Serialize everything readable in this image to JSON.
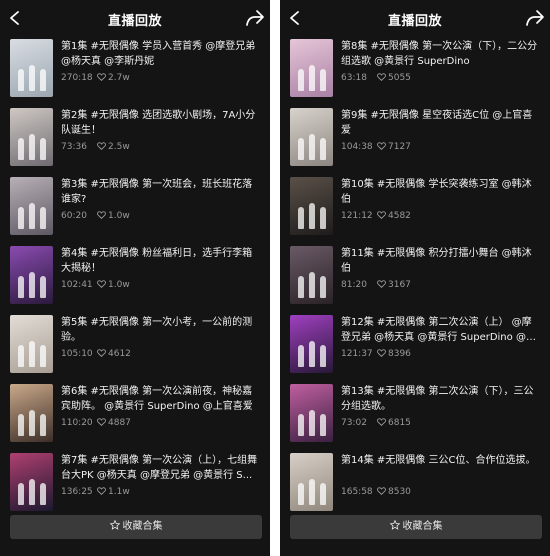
{
  "colors": {
    "background": "#141414",
    "text": "#f2f2f2",
    "meta": "#9a9a9a",
    "button": "#3a3a3a"
  },
  "left_panel": {
    "title": "直播回放",
    "button_label": "收藏合集",
    "episodes": [
      {
        "title": "第1集 #无限偶像 学员入营首秀 @摩登兄弟 @杨天真 @李斯丹妮",
        "duration": "270:18",
        "likes": "2.7w"
      },
      {
        "title": "第2集 #无限偶像 选团选歌小剧场，7A小分队诞生！",
        "duration": "73:36",
        "likes": "2.5w"
      },
      {
        "title": "第3集 #无限偶像 第一次班会，班长班花落谁家?",
        "duration": "60:20",
        "likes": "1.0w"
      },
      {
        "title": "第4集 #无限偶像 粉丝福利日，选手行李箱大揭秘！",
        "duration": "102:41",
        "likes": "1.0w"
      },
      {
        "title": "第5集 #无限偶像 第一次小考，一公前的测验。",
        "duration": "105:10",
        "likes": "4612"
      },
      {
        "title": "第6集 #无限偶像 第一次公演前夜，神秘嘉宾助阵。 @黄景行 SuperDino @上官喜爱",
        "duration": "110:20",
        "likes": "4887"
      },
      {
        "title": "第7集 #无限偶像 第一次公演（上），七组舞台大PK @杨天真 @摩登兄弟 @黄景行 S...",
        "duration": "136:25",
        "likes": "1.1w"
      }
    ]
  },
  "right_panel": {
    "title": "直播回放",
    "button_label": "收藏合集",
    "episodes": [
      {
        "title": "第8集 #无限偶像 第一次公演（下），二公分组选歌 @黄景行 SuperDino",
        "duration": "63:18",
        "likes": "5055"
      },
      {
        "title": "第9集 #无限偶像 星空夜话选C位 @上官喜爱",
        "duration": "104:38",
        "likes": "7127"
      },
      {
        "title": "第10集 #无限偶像 学长突袭练习室 @韩沐伯",
        "duration": "121:12",
        "likes": "4582"
      },
      {
        "title": "第11集 #无限偶像 积分打擂小舞台 @韩沐伯",
        "duration": "81:20",
        "likes": "3167"
      },
      {
        "title": "第12集 #无限偶像 第二次公演（上） @摩登兄弟 @杨天真 @黄景行 SuperDino @白...",
        "duration": "121:37",
        "likes": "8396"
      },
      {
        "title": "第13集 #无限偶像 第二次公演（下），三公分组选歌。",
        "duration": "73:02",
        "likes": "6815"
      },
      {
        "title": "第14集 #无限偶像 三公C位、合作位选拔。",
        "duration": "165:58",
        "likes": "8530"
      }
    ]
  }
}
